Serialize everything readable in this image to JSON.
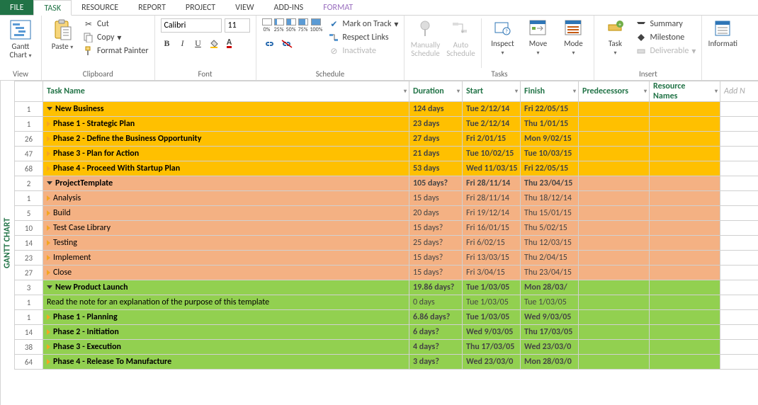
{
  "tabs": {
    "file": "FILE",
    "task": "TASK",
    "resource": "RESOURCE",
    "report": "REPORT",
    "project": "PROJECT",
    "view": "VIEW",
    "addins": "ADD-INS",
    "format": "FORMAT"
  },
  "ribbon": {
    "view": {
      "gantt": "Gantt\nChart",
      "group": "View"
    },
    "clipboard": {
      "paste": "Paste",
      "cut": "Cut",
      "copy": "Copy",
      "painter": "Format Painter",
      "group": "Clipboard"
    },
    "font": {
      "face": "Calibri",
      "size": "11",
      "group": "Font"
    },
    "schedule": {
      "markontrack": "Mark on Track",
      "respectlinks": "Respect Links",
      "inactivate": "Inactivate",
      "group": "Schedule",
      "percents": [
        "0%",
        "25%",
        "50%",
        "75%",
        "100%"
      ]
    },
    "tasks": {
      "manual": "Manually\nSchedule",
      "auto": "Auto\nSchedule",
      "inspect": "Inspect",
      "move": "Move",
      "mode": "Mode",
      "group": "Tasks"
    },
    "insert": {
      "task": "Task",
      "summary": "Summary",
      "milestone": "Milestone",
      "deliverable": "Deliverable",
      "group": "Insert"
    },
    "properties": {
      "information": "Informati"
    }
  },
  "vlabel": "GANTT CHART",
  "columns": {
    "taskname": "Task Name",
    "duration": "Duration",
    "start": "Start",
    "finish": "Finish",
    "predecessors": "Predecessors",
    "resourcenames": "Resource\nNames",
    "addnew": "Add N"
  },
  "rows": [
    {
      "n": "1",
      "name": "New Business",
      "dur": "124 days",
      "start": "Tue 2/12/14",
      "finish": "Fri 22/05/15",
      "cls": "yellow",
      "lvl": 0,
      "open": true,
      "bold": true
    },
    {
      "n": "1",
      "name": "Phase 1 - Strategic Plan",
      "dur": "23 days",
      "start": "Tue 2/12/14",
      "finish": "Thu 1/01/15",
      "cls": "yellow",
      "lvl": 1,
      "open": false,
      "bold": true
    },
    {
      "n": "26",
      "name": "Phase 2 - Define the Business Opportunity",
      "dur": "27 days",
      "start": "Fri 2/01/15",
      "finish": "Mon 9/02/15",
      "cls": "yellow",
      "lvl": 1,
      "open": false,
      "bold": true
    },
    {
      "n": "47",
      "name": "Phase 3 - Plan for Action",
      "dur": "21 days",
      "start": "Tue 10/02/15",
      "finish": "Tue 10/03/15",
      "cls": "yellow",
      "lvl": 1,
      "open": false,
      "bold": true
    },
    {
      "n": "68",
      "name": "Phase 4 - Proceed With Startup Plan",
      "dur": "53 days",
      "start": "Wed 11/03/15",
      "finish": "Fri 22/05/15",
      "cls": "yellow",
      "lvl": 1,
      "open": false,
      "bold": true
    },
    {
      "n": "2",
      "name": "ProjectTemplate",
      "dur": "105 days?",
      "start": "Fri 28/11/14",
      "finish": "Thu 23/04/15",
      "cls": "orange",
      "lvl": 0,
      "open": true,
      "bold": true
    },
    {
      "n": "1",
      "name": "Analysis",
      "dur": "15 days",
      "start": "Fri 28/11/14",
      "finish": "Thu 18/12/14",
      "cls": "orange",
      "lvl": 1,
      "open": false,
      "bold": false
    },
    {
      "n": "5",
      "name": "Build",
      "dur": "20 days",
      "start": "Fri 19/12/14",
      "finish": "Thu 15/01/15",
      "cls": "orange",
      "lvl": 1,
      "open": false,
      "bold": false
    },
    {
      "n": "10",
      "name": "Test Case Library",
      "dur": "15 days?",
      "start": "Fri 16/01/15",
      "finish": "Thu 5/02/15",
      "cls": "orange",
      "lvl": 1,
      "open": false,
      "bold": false
    },
    {
      "n": "14",
      "name": "Testing",
      "dur": "25 days?",
      "start": "Fri 6/02/15",
      "finish": "Thu 12/03/15",
      "cls": "orange",
      "lvl": 1,
      "open": false,
      "bold": false
    },
    {
      "n": "23",
      "name": "Implement",
      "dur": "15 days?",
      "start": "Fri 13/03/15",
      "finish": "Thu 2/04/15",
      "cls": "orange",
      "lvl": 1,
      "open": false,
      "bold": false
    },
    {
      "n": "27",
      "name": "Close",
      "dur": "15 days?",
      "start": "Fri 3/04/15",
      "finish": "Thu 23/04/15",
      "cls": "orange",
      "lvl": 1,
      "open": false,
      "bold": false
    },
    {
      "n": "3",
      "name": "New Product Launch",
      "dur": "19.86 days?",
      "start": "Tue 1/03/05",
      "finish": "Mon 28/03/",
      "cls": "green",
      "lvl": 0,
      "open": true,
      "bold": true
    },
    {
      "n": "1",
      "name": "Read the note for an explanation of the purpose of this template",
      "dur": "0 days",
      "start": "Tue 1/03/05",
      "finish": "Tue 1/03/05",
      "cls": "green",
      "lvl": 2,
      "open": null,
      "bold": false
    },
    {
      "n": "1",
      "name": "Phase 1 - Planning",
      "dur": "6.86 days?",
      "start": "Tue 1/03/05",
      "finish": "Wed 9/03/05",
      "cls": "green",
      "lvl": 1,
      "open": false,
      "bold": true
    },
    {
      "n": "14",
      "name": "Phase 2 - Initiation",
      "dur": "6 days?",
      "start": "Wed 9/03/05",
      "finish": "Thu 17/03/05",
      "cls": "green",
      "lvl": 1,
      "open": false,
      "bold": true
    },
    {
      "n": "38",
      "name": "Phase 3 - Execution",
      "dur": "4 days?",
      "start": "Thu 17/03/05",
      "finish": "Wed 23/03/0",
      "cls": "green",
      "lvl": 1,
      "open": false,
      "bold": true
    },
    {
      "n": "64",
      "name": "Phase 4 - Release To Manufacture",
      "dur": "3 days?",
      "start": "Wed 23/03/0",
      "finish": "Mon 28/03/0",
      "cls": "green",
      "lvl": 1,
      "open": false,
      "bold": true
    }
  ]
}
